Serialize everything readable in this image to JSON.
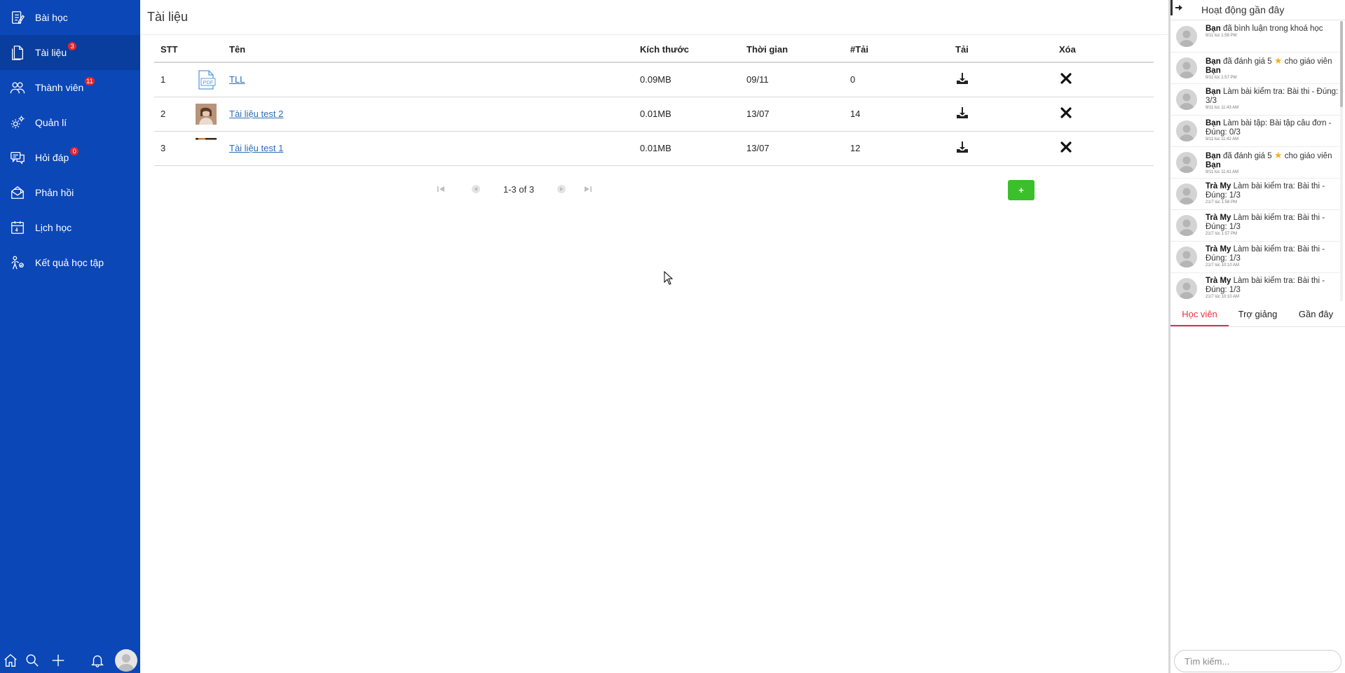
{
  "sidebar": {
    "items": [
      {
        "label": "Bài học",
        "icon": "lesson-icon",
        "badge": null
      },
      {
        "label": "Tài liệu",
        "icon": "document-icon",
        "badge": "3"
      },
      {
        "label": "Thành viên",
        "icon": "members-icon",
        "badge": "11"
      },
      {
        "label": "Quản lí",
        "icon": "gear-icon",
        "badge": null
      },
      {
        "label": "Hỏi đáp",
        "icon": "chat-icon",
        "badge": "0"
      },
      {
        "label": "Phản hồi",
        "icon": "feedback-icon",
        "badge": null
      },
      {
        "label": "Lịch học",
        "icon": "calendar-icon",
        "badge": null
      },
      {
        "label": "Kết quả học tập",
        "icon": "results-icon",
        "badge": null
      }
    ],
    "active_index": 1,
    "footer_icons": [
      "home-icon",
      "search-icon",
      "plus-icon",
      "bell-icon",
      "avatar"
    ]
  },
  "main": {
    "title": "Tài liệu",
    "table": {
      "headers": [
        "STT",
        "Tên",
        "Kích thước",
        "Thời gian",
        "#Tải",
        "Tải",
        "Xóa"
      ],
      "rows": [
        {
          "stt": "1",
          "thumb": "pdf-icon",
          "name": "TLL",
          "size": "0.09MB",
          "time": "09/11",
          "downloads": "0"
        },
        {
          "stt": "2",
          "thumb": "image-thumbnail",
          "name": "Tài liệu test 2",
          "size": "0.01MB",
          "time": "13/07",
          "downloads": "14"
        },
        {
          "stt": "3",
          "thumb": "image-thumbnail",
          "name": "Tài liệu test 1",
          "size": "0.01MB",
          "time": "13/07",
          "downloads": "12"
        }
      ]
    },
    "pager": {
      "text": "1-3 of 3"
    },
    "add_label": "+"
  },
  "right_panel": {
    "title": "Hoạt động gần đây",
    "activities": [
      {
        "who": "Bạn",
        "text": "đã bình luận trong khoá học",
        "time": "9/11 lúc 1:58 PM",
        "star": false
      },
      {
        "who": "Bạn",
        "text": "đã đánh giá 5",
        "text2": "cho giáo viên",
        "who2": "Bạn",
        "time": "9/11 lúc 1:57 PM",
        "star": true
      },
      {
        "who": "Bạn",
        "text": "Làm bài kiểm tra: Bài thi - Đúng: 3/3",
        "time": "9/11 lúc 11:43 AM",
        "star": false
      },
      {
        "who": "Bạn",
        "text": "Làm bài tập: Bài tập câu đơn - Đúng: 0/3",
        "time": "9/11 lúc 11:42 AM",
        "star": false
      },
      {
        "who": "Bạn",
        "text": "đã đánh giá 5",
        "text2": "cho giáo viên",
        "who2": "Bạn",
        "time": "9/11 lúc 11:41 AM",
        "star": true
      },
      {
        "who": "Trà My",
        "text": "Làm bài kiểm tra: Bài thi - Đúng: 1/3",
        "time": "21/7 lúc 1:58 PM",
        "star": false
      },
      {
        "who": "Trà My",
        "text": "Làm bài kiểm tra: Bài thi - Đúng: 1/3",
        "time": "21/7 lúc 1:57 PM",
        "star": false
      },
      {
        "who": "Trà My",
        "text": "Làm bài kiểm tra: Bài thi - Đúng: 1/3",
        "time": "21/7 lúc 10:10 AM",
        "star": false
      },
      {
        "who": "Trà My",
        "text": "Làm bài kiểm tra: Bài thi - Đúng: 1/3",
        "time": "21/7 lúc 10:10 AM",
        "star": false
      }
    ],
    "tabs": [
      "Học viên",
      "Trợ giảng",
      "Gần đây"
    ],
    "active_tab": 0,
    "search_placeholder": "Tìm kiếm..."
  },
  "colors": {
    "sidebar_bg": "#0b47b7",
    "accent_red": "#e0343a",
    "add_green": "#3bbf2b",
    "link": "#2a6eb8"
  }
}
